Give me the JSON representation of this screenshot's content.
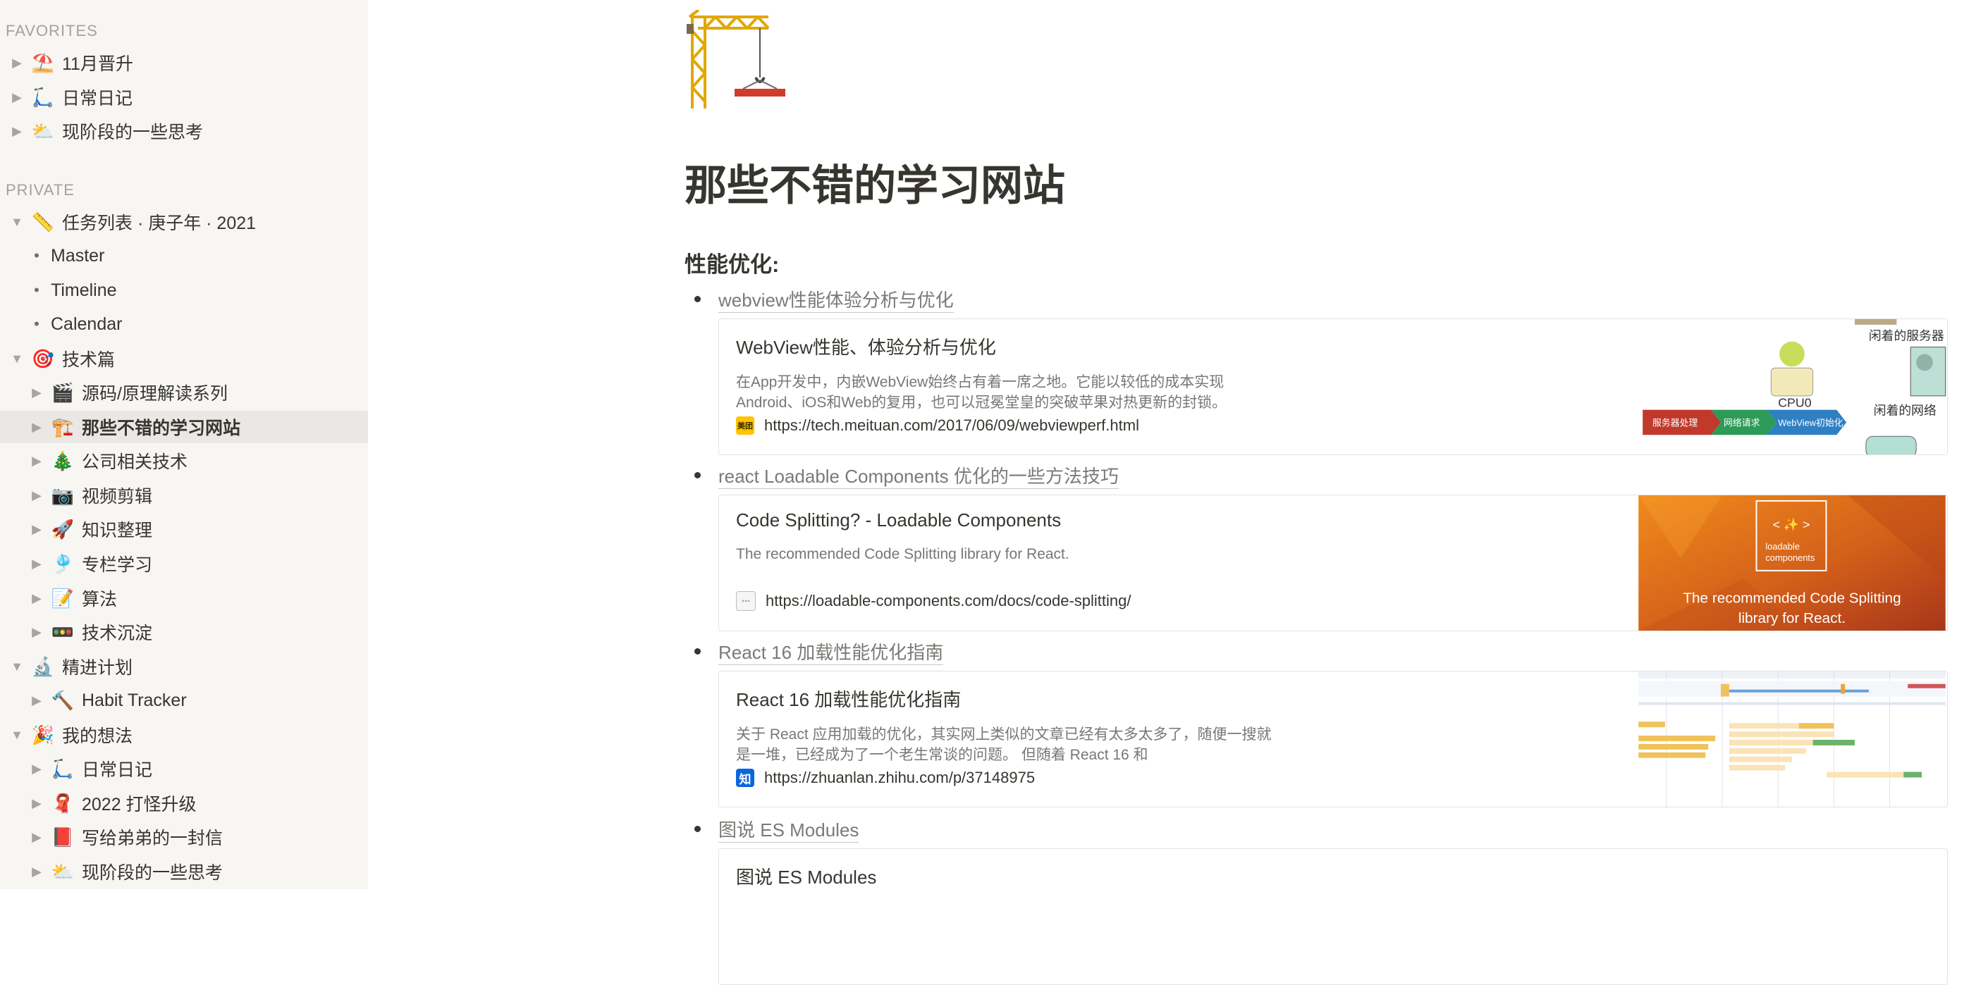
{
  "sidebar": {
    "favorites_label": "FAVORITES",
    "private_label": "PRIVATE",
    "favorites": [
      {
        "emoji": "⛱️",
        "label": "11月晋升"
      },
      {
        "emoji": "🛴",
        "label": "日常日记"
      },
      {
        "emoji": "⛅",
        "label": "现阶段的一些思考"
      }
    ],
    "private": [
      {
        "emoji": "📏",
        "label": "任务列表 · 庚子年 · 2021"
      },
      {
        "label": "Master"
      },
      {
        "label": "Timeline"
      },
      {
        "label": "Calendar"
      },
      {
        "emoji": "🎯",
        "label": "技术篇"
      },
      {
        "emoji": "🎬",
        "label": "源码/原理解读系列"
      },
      {
        "emoji": "🏗️",
        "label": "那些不错的学习网站"
      },
      {
        "emoji": "🎄",
        "label": "公司相关技术"
      },
      {
        "emoji": "📷",
        "label": "视频剪辑"
      },
      {
        "emoji": "🚀",
        "label": "知识整理"
      },
      {
        "emoji": "🎐",
        "label": "专栏学习"
      },
      {
        "emoji": "📝",
        "label": "算法"
      },
      {
        "emoji": "🚥",
        "label": "技术沉淀"
      },
      {
        "emoji": "🔬",
        "label": "精进计划"
      },
      {
        "emoji": "🔨",
        "label": "Habit Tracker"
      },
      {
        "emoji": "🎉",
        "label": "我的想法"
      },
      {
        "emoji": "🛴",
        "label": "日常日记"
      },
      {
        "emoji": "🧣",
        "label": "2022 打怪升级"
      },
      {
        "emoji": "📕",
        "label": "写给弟弟的一封信"
      },
      {
        "emoji": "⛅",
        "label": "现阶段的一些思考"
      }
    ]
  },
  "page": {
    "title": "那些不错的学习网站",
    "icon": "construction-crane-icon",
    "section_heading": "性能优化:"
  },
  "links": [
    {
      "text": "webview性能体验分析与优化",
      "bookmark": {
        "title": "WebView性能、体验分析与优化",
        "desc": "在App开发中，内嵌WebView始终占有着一席之地。它能以较低的成本实现Android、iOS和Web的复用，也可以冠冕堂皇的突破苹果对热更新的封锁。",
        "url": "https://tech.meituan.com/2017/06/09/webviewperf.html",
        "favicon_text": "美团",
        "image_labels": {
          "server": "闲着的服务器",
          "network": "闲着的网络",
          "cpu": "CPU0",
          "step1": "服务器处理",
          "step2": "网络请求",
          "step3": "WebView初始化"
        }
      }
    },
    {
      "text": "react Loadable Components 优化的一些方法技巧",
      "bookmark": {
        "title": "Code Splitting? - Loadable Components",
        "desc": "The recommended Code Splitting library for React.",
        "url": "https://loadable-components.com/docs/code-splitting/",
        "image_labels": {
          "logo_top": "< ✨ >",
          "logo_a": "loadable",
          "logo_b": "components",
          "tag1": "The recommended Code Splitting",
          "tag2": "library for React."
        }
      }
    },
    {
      "text": "React 16 加载性能优化指南",
      "bookmark": {
        "title": "React 16 加载性能优化指南",
        "desc": "关于 React 应用加载的优化，其实网上类似的文章已经有太多太多了，随便一搜就是一堆，已经成为了一个老生常谈的问题。 但随着 React 16 和",
        "url": "https://zhuanlan.zhihu.com/p/37148975",
        "favicon_text": "知"
      }
    },
    {
      "text": "图说 ES Modules",
      "bookmark": {
        "title": "图说 ES Modules"
      }
    }
  ],
  "colors": {
    "sidebar_bg": "#f7f6f3",
    "active_bg": "#e9e8e4",
    "text": "#37352f",
    "muted": "#787774",
    "meituan": "#ffc300",
    "zhihu": "#0a66e0"
  }
}
